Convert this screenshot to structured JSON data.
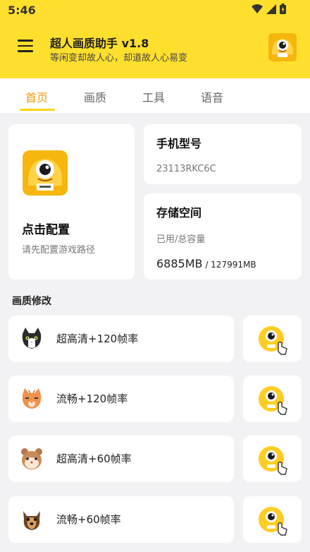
{
  "status_bar": {
    "time": "5:46"
  },
  "header": {
    "title": "超人画质助手 v1.8",
    "subtitle": "等闲变却故人心，却道故人心易变"
  },
  "tabs": [
    {
      "label": "首页",
      "active": true
    },
    {
      "label": "画质",
      "active": false
    },
    {
      "label": "工具",
      "active": false
    },
    {
      "label": "语音",
      "active": false
    }
  ],
  "config_card": {
    "title": "点击配置",
    "subtitle": "请先配置游戏路径"
  },
  "phone_card": {
    "title": "手机型号",
    "value": "23113RKC6C"
  },
  "storage_card": {
    "title": "存储空间",
    "subtitle": "已用/总容量",
    "used": "6885MB",
    "total": " / 127991MB"
  },
  "section": {
    "title": "画质修改"
  },
  "presets": [
    {
      "label": "超高清+120帧率",
      "icon": "black-white-cat-icon"
    },
    {
      "label": "流畅+120帧率",
      "icon": "orange-cat-icon"
    },
    {
      "label": "超高清+60帧率",
      "icon": "hamster-icon"
    },
    {
      "label": "流畅+60帧率",
      "icon": "dog-icon"
    }
  ],
  "colors": {
    "accent": "#ffdf2e",
    "tab_active": "#f29a10",
    "background": "#f2f2f4"
  }
}
